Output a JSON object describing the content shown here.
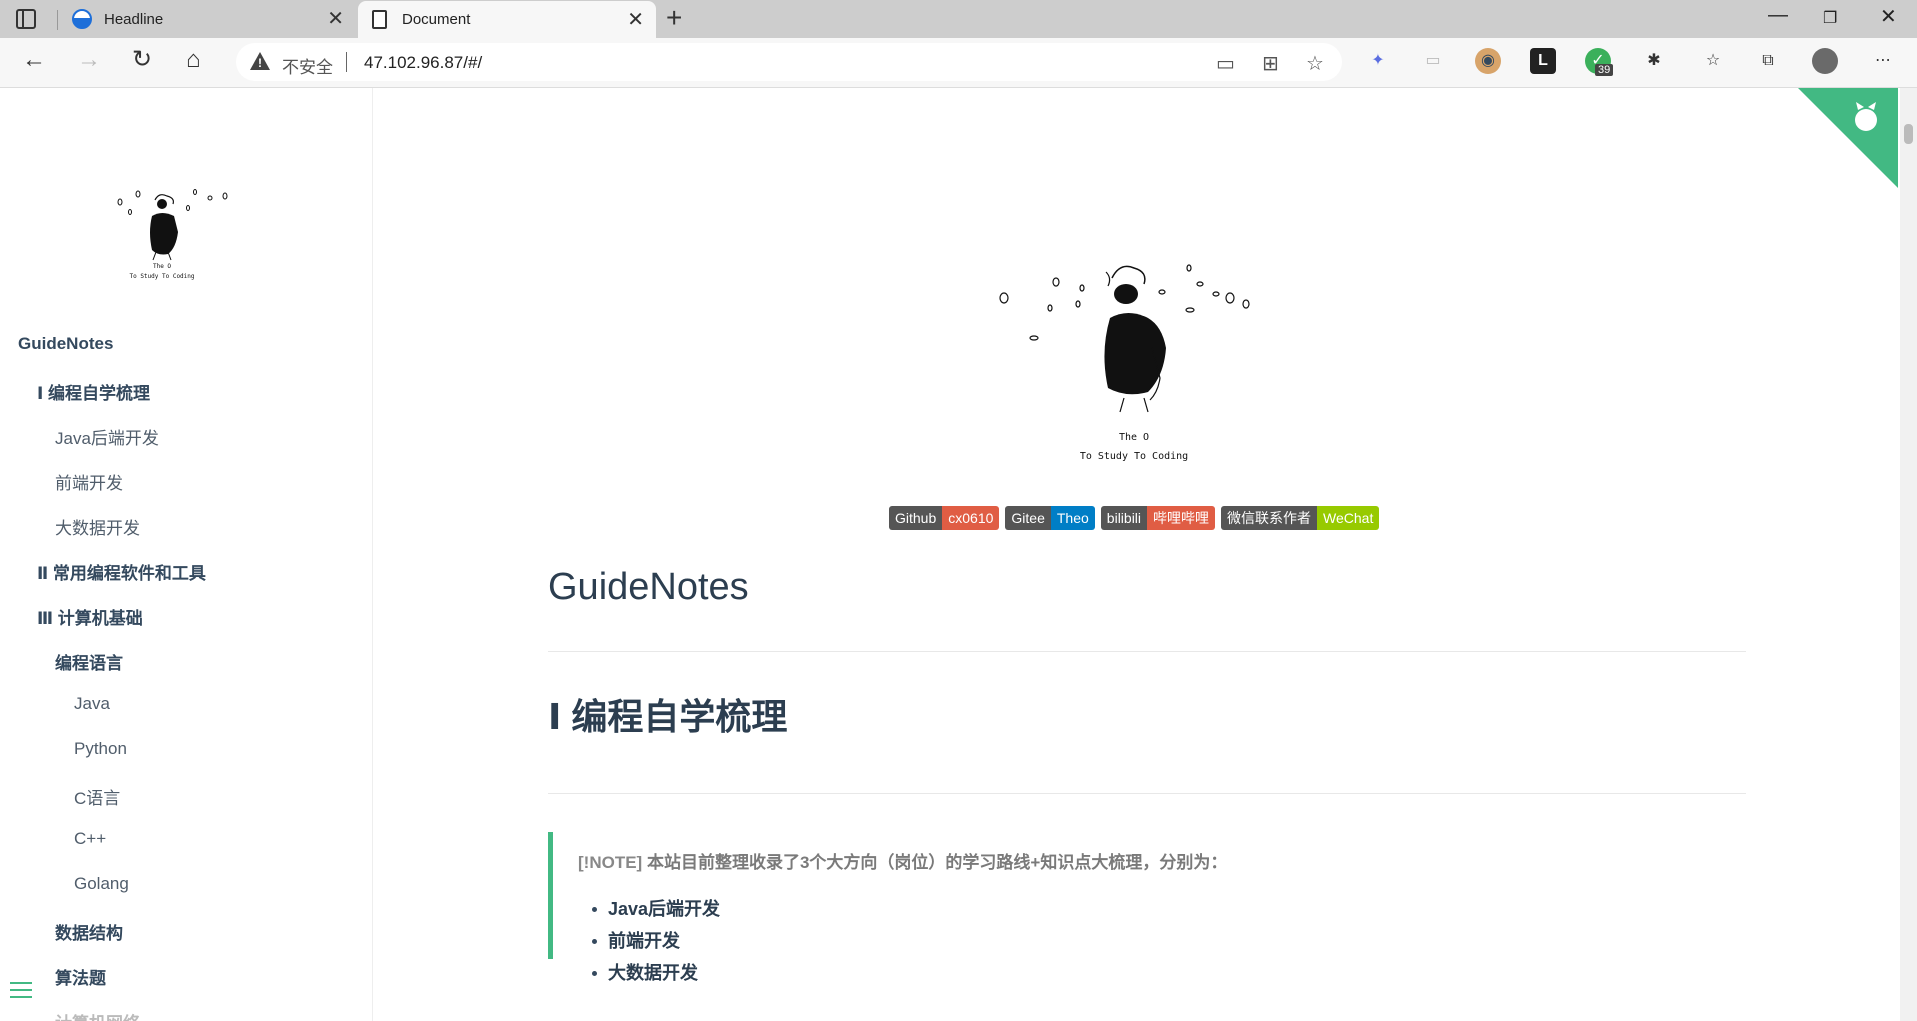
{
  "browser": {
    "tabs": [
      {
        "title": "Headline"
      },
      {
        "title": "Document"
      }
    ],
    "address": {
      "security_label": "不安全",
      "url": "47.102.96.87/#/"
    },
    "extension_badge": "39"
  },
  "sidebar": {
    "logo_caption_1": "The O",
    "logo_caption_2": "To Study To Coding",
    "items": [
      {
        "label": "GuideNotes"
      },
      {
        "label": "Ⅰ 编程自学梳理"
      },
      {
        "label": "Java后端开发"
      },
      {
        "label": "前端开发"
      },
      {
        "label": "大数据开发"
      },
      {
        "label": "Ⅱ 常用编程软件和工具"
      },
      {
        "label": "Ⅲ 计算机基础"
      },
      {
        "label": "编程语言"
      },
      {
        "label": "Java"
      },
      {
        "label": "Python"
      },
      {
        "label": "C语言"
      },
      {
        "label": "C++"
      },
      {
        "label": "Golang"
      },
      {
        "label": "数据结构"
      },
      {
        "label": "算法题"
      },
      {
        "label": "计算机网络"
      }
    ]
  },
  "main": {
    "hero_caption_1": "The O",
    "hero_caption_2": "To Study To Coding",
    "badges": [
      {
        "left": "Github",
        "right": "cx0610",
        "color": "#e05d44"
      },
      {
        "left": "Gitee",
        "right": "Theo",
        "color": "#007ec6"
      },
      {
        "left": "bilibili",
        "right": "哔哩哔哩",
        "color": "#e05d44"
      },
      {
        "left": "微信联系作者",
        "right": "WeChat",
        "color": "#97ca00"
      }
    ],
    "title": "GuideNotes",
    "section_title": "Ⅰ 编程自学梳理",
    "note_tag": "[!NOTE]",
    "note_text": "本站目前整理收录了3个大方向（岗位）的学习路线+知识点大梳理，分别为：",
    "note_list": [
      "Java后端开发",
      "前端开发",
      "大数据开发"
    ]
  },
  "colors": {
    "accent": "#42b983",
    "text": "#34495e"
  }
}
